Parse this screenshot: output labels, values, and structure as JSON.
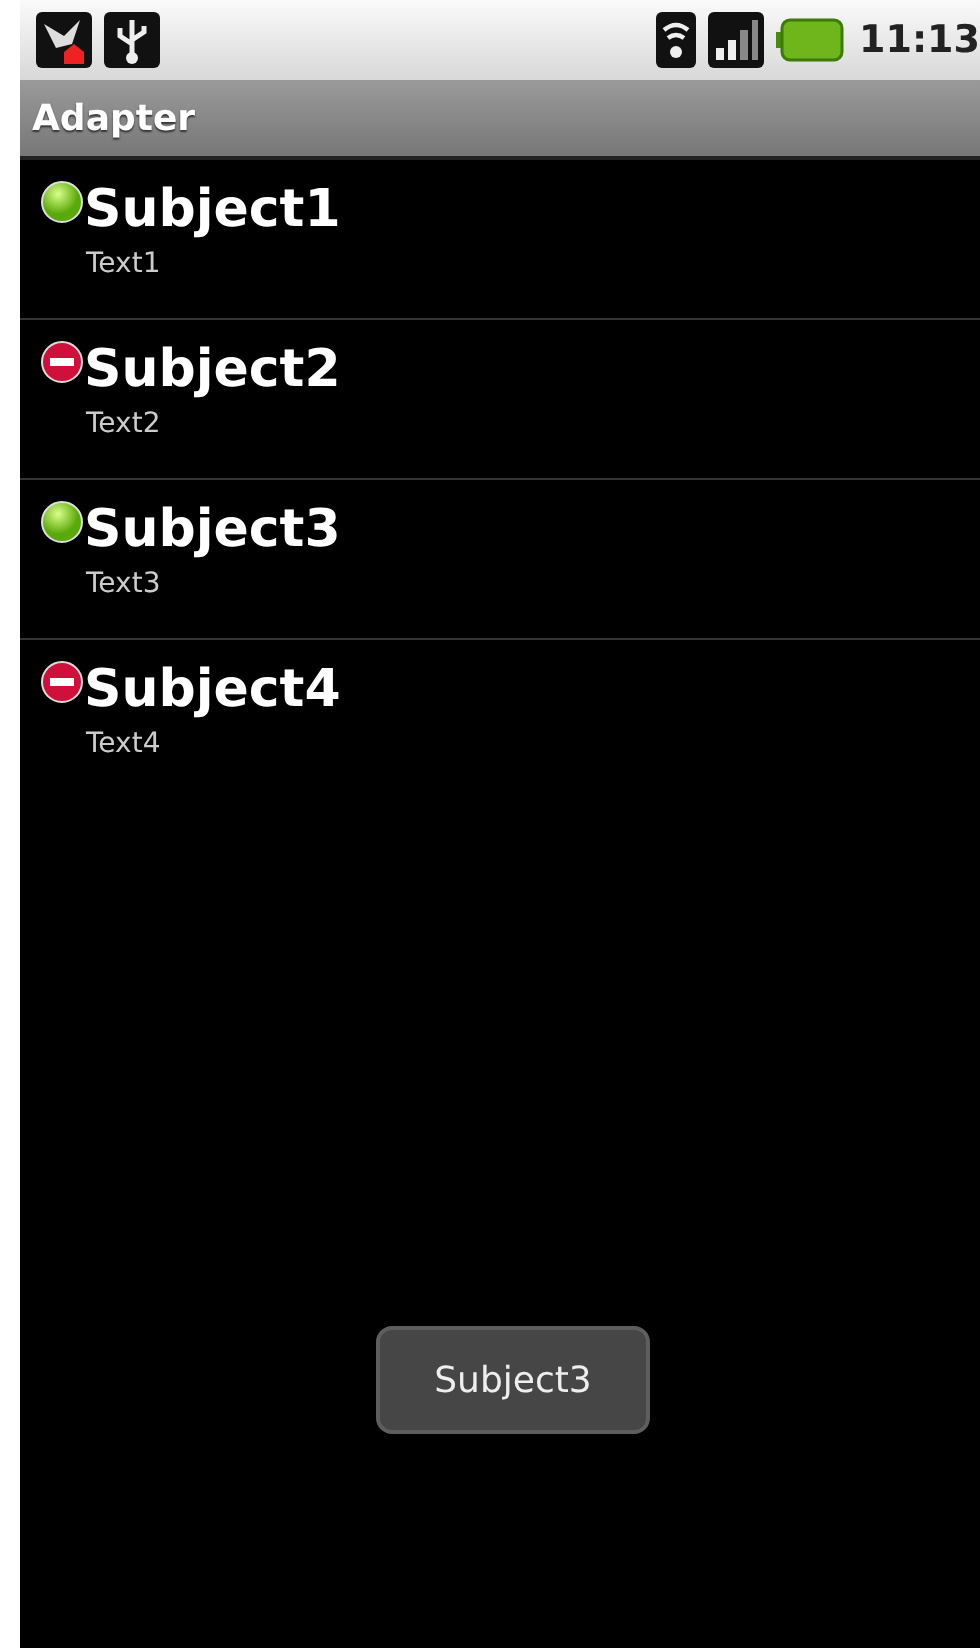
{
  "status_bar": {
    "time": "11:13"
  },
  "title_bar": {
    "title": "Adapter"
  },
  "items": [
    {
      "subject": "Subject1",
      "text": "Text1",
      "kind": "available"
    },
    {
      "subject": "Subject2",
      "text": "Text2",
      "kind": "blocked"
    },
    {
      "subject": "Subject3",
      "text": "Text3",
      "kind": "available"
    },
    {
      "subject": "Subject4",
      "text": "Text4",
      "kind": "blocked"
    }
  ],
  "toast": {
    "text": "Subject3"
  }
}
